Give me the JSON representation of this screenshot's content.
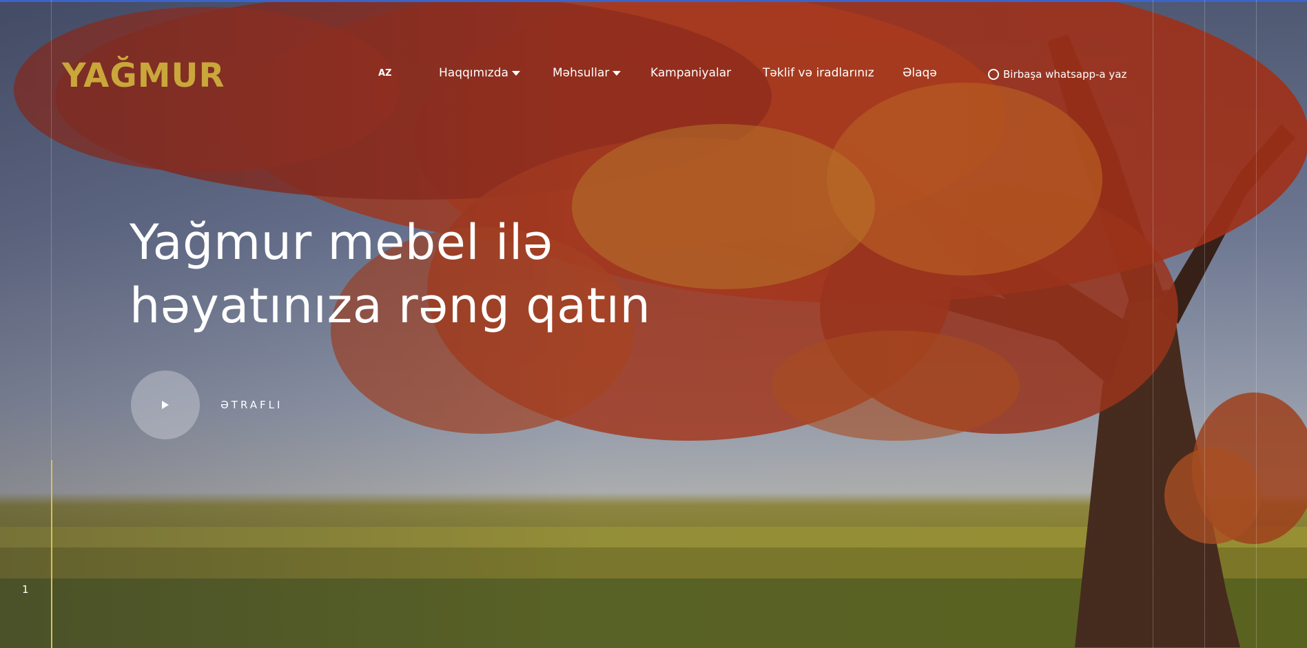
{
  "brand": {
    "logo_text": "YAĞMUR",
    "logo_color": "#c9a73a"
  },
  "nav": {
    "language": "AZ",
    "items": [
      {
        "label": "Haqqımızda",
        "has_dropdown": true
      },
      {
        "label": "Məhsullar",
        "has_dropdown": true
      },
      {
        "label": "Kampaniyalar",
        "has_dropdown": false
      },
      {
        "label": "Təklif və iradlarınız",
        "has_dropdown": false
      },
      {
        "label": "Əlaqə",
        "has_dropdown": false
      }
    ],
    "whatsapp": {
      "icon": "whatsapp-icon",
      "label": "Birbaşa whatsapp-a yaz"
    }
  },
  "hero": {
    "headline_line1": "Yağmur mebel ilə",
    "headline_line2": "həyatınıza rəng qatın",
    "play_icon": "play-icon",
    "more_label": "ƏTRAFLI",
    "slide_number": "1"
  },
  "colors": {
    "top_line": "#3c63c8",
    "accent_gold": "#d9c25a",
    "text": "#ffffff"
  }
}
